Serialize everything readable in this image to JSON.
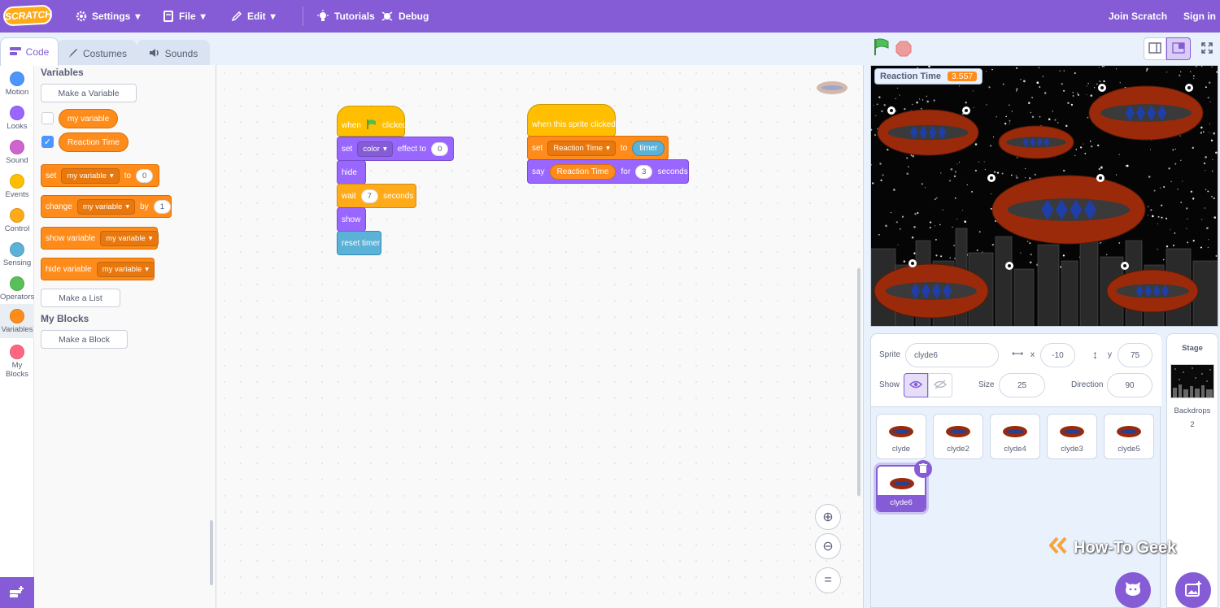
{
  "menubar": {
    "logo": "SCRATCH",
    "settings": "Settings",
    "file": "File",
    "edit": "Edit",
    "tutorials": "Tutorials",
    "debug": "Debug",
    "join": "Join Scratch",
    "signin": "Sign in"
  },
  "tabs": {
    "code": "Code",
    "costumes": "Costumes",
    "sounds": "Sounds"
  },
  "categories": [
    {
      "label": "Motion",
      "color": "#4c97ff"
    },
    {
      "label": "Looks",
      "color": "#9966ff"
    },
    {
      "label": "Sound",
      "color": "#cf63cf"
    },
    {
      "label": "Events",
      "color": "#ffbf00"
    },
    {
      "label": "Control",
      "color": "#ffab19"
    },
    {
      "label": "Sensing",
      "color": "#5cb1d6"
    },
    {
      "label": "Operators",
      "color": "#59c059"
    },
    {
      "label": "Variables",
      "color": "#ff8c1a"
    },
    {
      "label": "My Blocks",
      "color": "#ff6680"
    }
  ],
  "palette": {
    "heading_variables": "Variables",
    "make_variable": "Make a Variable",
    "var1": "my variable",
    "var2": "Reaction Time",
    "set_block": {
      "verb": "set",
      "var": "my variable",
      "to": "to",
      "value": "0"
    },
    "change_block": {
      "verb": "change",
      "var": "my variable",
      "by": "by",
      "value": "1"
    },
    "show_block": {
      "verb": "show variable",
      "var": "my variable"
    },
    "hide_block": {
      "verb": "hide variable",
      "var": "my variable"
    },
    "make_list": "Make a List",
    "heading_myblocks": "My Blocks",
    "make_block": "Make a Block"
  },
  "script1": {
    "hat_when": "when",
    "hat_clicked": "clicked",
    "set": "set",
    "effect": "color",
    "effect_to": "effect to",
    "effect_value": "0",
    "hide": "hide",
    "wait": "wait",
    "wait_value": "7",
    "seconds": "seconds",
    "show": "show",
    "reset": "reset timer"
  },
  "script2": {
    "hat": "when this sprite clicked",
    "set": "set",
    "var": "Reaction Time",
    "to": "to",
    "timer": "timer",
    "say": "say",
    "say_var": "Reaction Time",
    "for": "for",
    "for_value": "3",
    "seconds": "seconds"
  },
  "monitor": {
    "label": "Reaction Time",
    "value": "3.557"
  },
  "sprite_info": {
    "sprite_label": "Sprite",
    "sprite_name": "clyde6",
    "x_label": "x",
    "x": "-10",
    "y_label": "y",
    "y": "75",
    "show_label": "Show",
    "size_label": "Size",
    "size": "25",
    "direction_label": "Direction",
    "direction": "90"
  },
  "sprites": [
    "clyde",
    "clyde2",
    "clyde4",
    "clyde3",
    "clyde5",
    "clyde6"
  ],
  "stage_pane": {
    "title": "Stage",
    "backdrops_label": "Backdrops",
    "backdrops_count": "2"
  },
  "watermark": "How-To Geek"
}
